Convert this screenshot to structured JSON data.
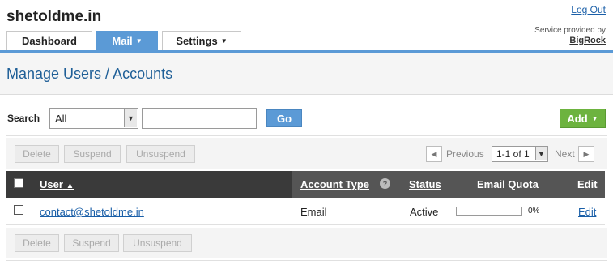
{
  "header": {
    "site_title": "shetoldme.in",
    "logout_label": "Log Out",
    "service_text": "Service provided by",
    "service_brand": "BigRock"
  },
  "tabs": [
    {
      "label": "Dashboard",
      "active": false,
      "has_dropdown": false
    },
    {
      "label": "Mail",
      "active": true,
      "has_dropdown": true
    },
    {
      "label": "Settings",
      "active": false,
      "has_dropdown": true
    }
  ],
  "page": {
    "title": "Manage Users / Accounts"
  },
  "search": {
    "label": "Search",
    "filter_value": "All",
    "input_value": "",
    "go_label": "Go"
  },
  "add_button": {
    "label": "Add"
  },
  "bulk_actions": {
    "delete_label": "Delete",
    "suspend_label": "Suspend",
    "unsuspend_label": "Unsuspend"
  },
  "pager": {
    "previous_label": "Previous",
    "page_value": "1-1 of 1",
    "next_label": "Next"
  },
  "table": {
    "columns": {
      "user": "User",
      "account_type": "Account Type",
      "status": "Status",
      "email_quota": "Email Quota",
      "edit": "Edit"
    },
    "rows": [
      {
        "user": "contact@shetoldme.in",
        "account_type": "Email",
        "status": "Active",
        "quota_percent": 0,
        "quota_label": "0%",
        "edit_label": "Edit"
      }
    ]
  },
  "colors": {
    "accent": "#5b9ad6",
    "add_green": "#6db33f",
    "header_dark": "#555555",
    "link": "#1a5fa8"
  }
}
